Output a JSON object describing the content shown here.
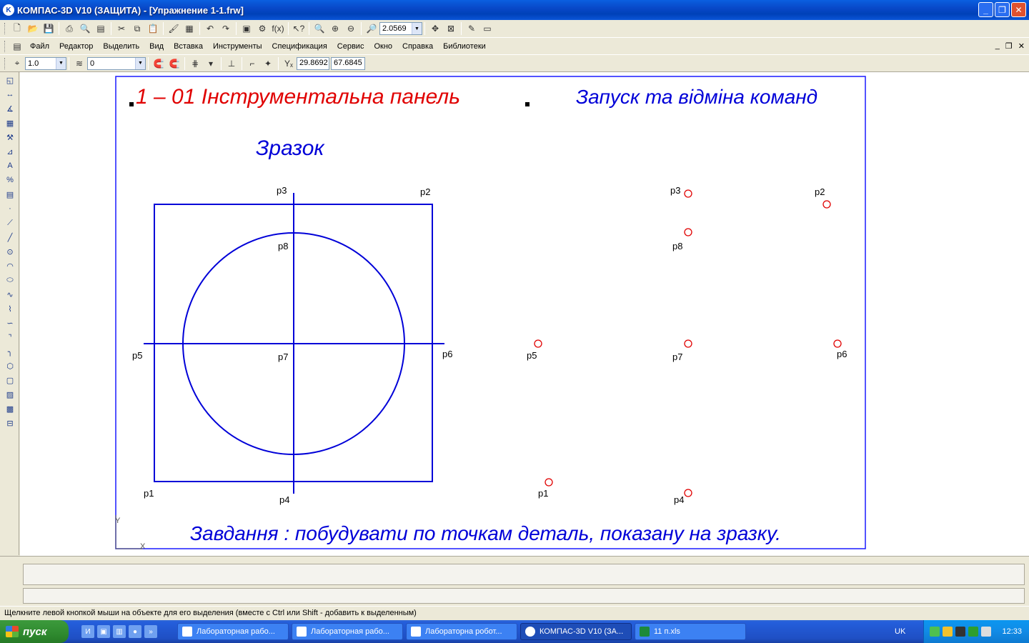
{
  "window": {
    "title": "КОМПАС-3D V10 (ЗАЩИТА) - [Упражнение 1-1.frw]",
    "icon": "kompas-logo-icon",
    "controls": [
      "minimize-icon",
      "restore-icon",
      "close-icon"
    ]
  },
  "toolbar_standard": {
    "zoom_value": "2.0569"
  },
  "menu": {
    "items": [
      "Файл",
      "Редактор",
      "Выделить",
      "Вид",
      "Вставка",
      "Инструменты",
      "Спецификация",
      "Сервис",
      "Окно",
      "Справка",
      "Библиотеки"
    ]
  },
  "toolbar_current": {
    "step": "1.0",
    "layer": "0",
    "coord_x": "29.8692",
    "coord_y": "67.6845"
  },
  "drawing": {
    "heading_red": "1 – 01 Інструментальна панель",
    "heading_blue": "Запуск та відміна команд",
    "sample_label": "Зразок",
    "task_text": "Завдання : побудувати по точкам деталь, показану на зразку.",
    "axis_y": "Y",
    "axis_x": "X",
    "sample_points": [
      "p1",
      "p2",
      "p3",
      "p4",
      "p5",
      "p6",
      "p7",
      "p8"
    ],
    "target_points": [
      "p1",
      "p2",
      "p3",
      "p4",
      "p5",
      "p6",
      "p7",
      "p8"
    ],
    "colors": {
      "red": "#e00000",
      "blue": "#0000d8",
      "frame": "#1a1aff",
      "point": "#e00000"
    }
  },
  "statusbar": {
    "hint": "Щелкните левой кнопкой мыши на объекте для его выделения (вместе с Ctrl или Shift - добавить к выделенным)"
  },
  "taskbar": {
    "start_label": "пуск",
    "tasks": [
      {
        "label": "Лабораторная рабо...",
        "icon": "word-icon",
        "active": false
      },
      {
        "label": "Лабораторная рабо...",
        "icon": "word-icon",
        "active": false
      },
      {
        "label": "Лабораторна робот...",
        "icon": "word-icon",
        "active": false
      },
      {
        "label": "КОМПАС-3D V10 (ЗА...",
        "icon": "kompas-icon",
        "active": true
      },
      {
        "label": "11 п.xls",
        "icon": "excel-icon",
        "active": false
      }
    ],
    "language": "UK",
    "clock": "12:33"
  }
}
